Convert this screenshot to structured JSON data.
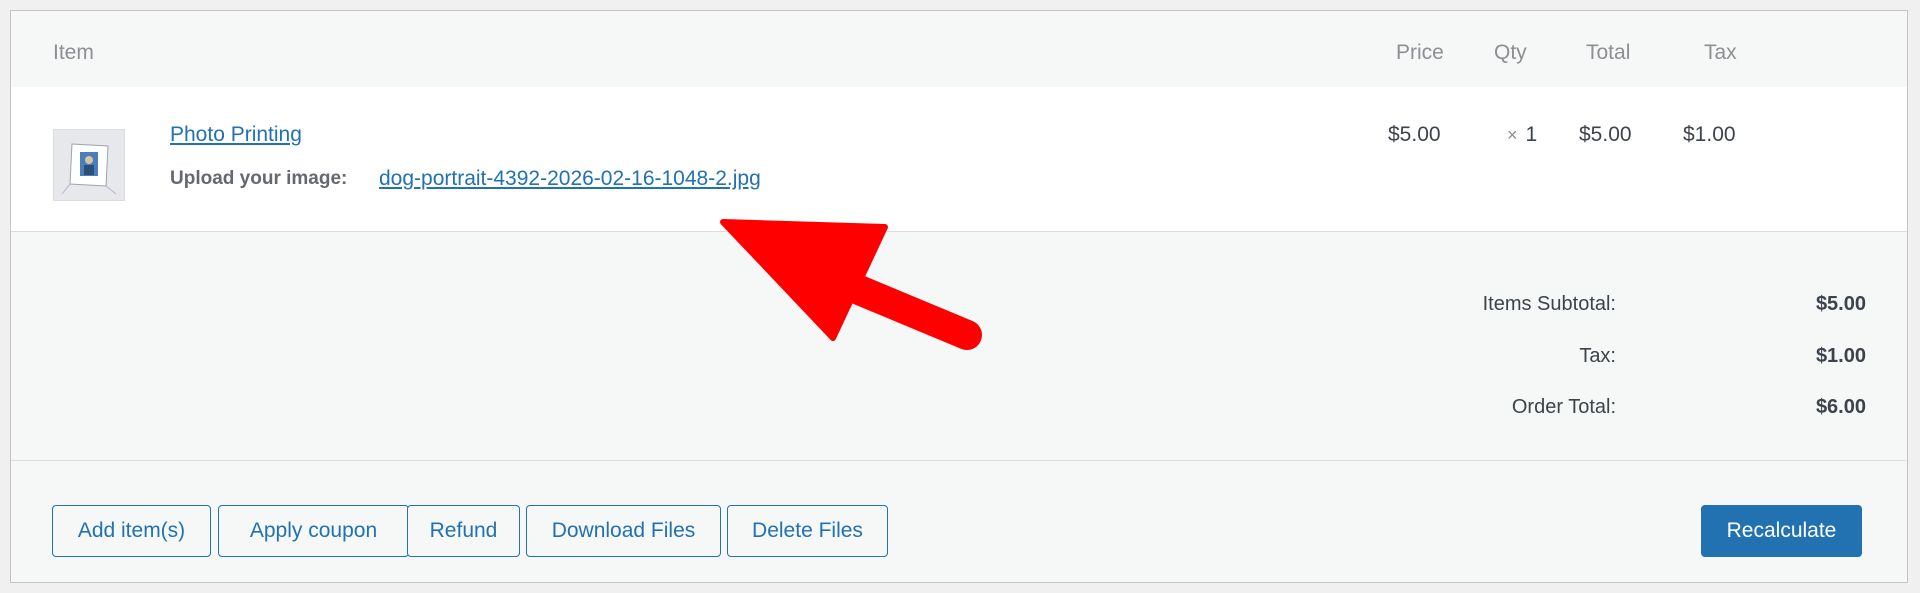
{
  "table": {
    "headers": {
      "item": "Item",
      "price": "Price",
      "qty": "Qty",
      "total": "Total",
      "tax": "Tax"
    }
  },
  "line_item": {
    "product_name": "Photo Printing",
    "meta_label": "Upload your image:",
    "meta_value": "dog-portrait-4392-2026-02-16-1048-2.jpg",
    "price": "$5.00",
    "qty_symbol": "×",
    "qty": "1",
    "total": "$5.00",
    "tax": "$1.00"
  },
  "totals": {
    "subtotal_label": "Items Subtotal:",
    "subtotal_value": "$5.00",
    "tax_label": "Tax:",
    "tax_value": "$1.00",
    "order_total_label": "Order Total:",
    "order_total_value": "$6.00"
  },
  "actions": {
    "add_items": "Add item(s)",
    "apply_coupon": "Apply coupon",
    "refund": "Refund",
    "download_files": "Download Files",
    "delete_files": "Delete Files",
    "recalculate": "Recalculate"
  },
  "colors": {
    "accent": "#2271b1",
    "arrow": "#ff0000"
  }
}
